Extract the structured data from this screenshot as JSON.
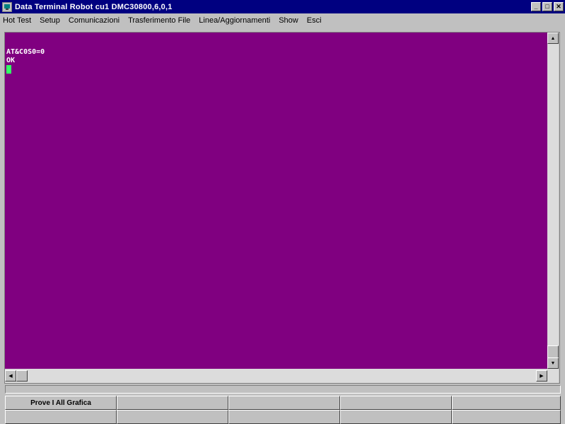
{
  "window": {
    "title": "Data Terminal Robot cu1 DMC30800,6,0,1",
    "minimize_glyph": "_",
    "maximize_glyph": "□",
    "close_glyph": "✕"
  },
  "menu": {
    "items": [
      "Hot Test",
      "Setup",
      "Comunicazioni",
      "Trasferimento File",
      "Linea/Aggiornamenti",
      "Show",
      "Esci"
    ]
  },
  "terminal": {
    "background": "#800080",
    "cursor_color": "#33ff66",
    "lines": [
      "AT&C0S0=0",
      "OK"
    ]
  },
  "scrollbar": {
    "up_glyph": "▲",
    "down_glyph": "▼",
    "left_glyph": "◀",
    "right_glyph": "▶"
  },
  "function_keys": {
    "row1": [
      "Prove I All Grafica",
      "",
      "",
      "",
      ""
    ],
    "row2": [
      "",
      "",
      "",
      "",
      ""
    ]
  }
}
